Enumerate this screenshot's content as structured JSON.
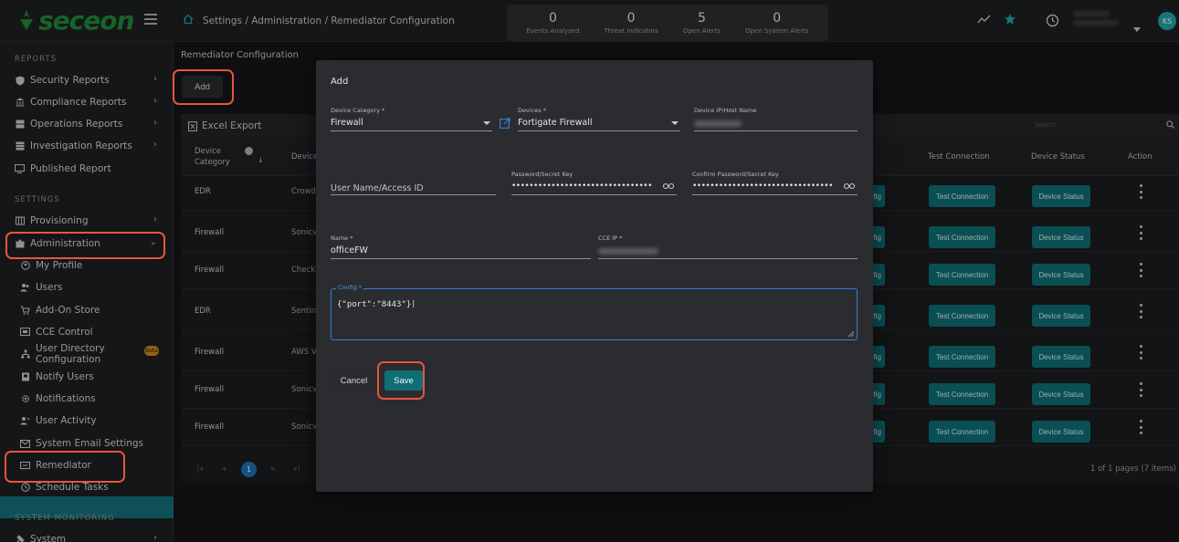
{
  "header": {
    "logo_text": "seceon",
    "breadcrumb": "Settings / Administration / Remediator Configuration",
    "stats": [
      {
        "value": "0",
        "label": "Events Analyzed"
      },
      {
        "value": "0",
        "label": "Threat Indicators"
      },
      {
        "value": "5",
        "label": "Open Alerts"
      },
      {
        "value": "0",
        "label": "Open System Alerts"
      }
    ],
    "avatar_initials": "KS",
    "brand_color": "#1f8a3a",
    "accent_color": "#12707a"
  },
  "sidebar": {
    "reports_title": "REPORTS",
    "reports": [
      {
        "label": "Security Reports",
        "icon": "shield-icon"
      },
      {
        "label": "Compliance Reports",
        "icon": "bank-icon"
      },
      {
        "label": "Operations Reports",
        "icon": "server-icon"
      },
      {
        "label": "Investigation Reports",
        "icon": "table-icon"
      },
      {
        "label": "Published Report",
        "icon": "monitor-icon"
      }
    ],
    "settings_title": "SETTINGS",
    "settings": [
      {
        "label": "Provisioning",
        "icon": "provisioning-icon"
      },
      {
        "label": "Administration",
        "icon": "admin-icon"
      }
    ],
    "admin_sub": [
      {
        "label": "My Profile",
        "icon": "profile-icon"
      },
      {
        "label": "Users",
        "icon": "users-icon"
      },
      {
        "label": "Add-On Store",
        "icon": "cart-icon"
      },
      {
        "label": "CCE Control",
        "icon": "control-icon"
      },
      {
        "label": "User Directory Configuration",
        "icon": "sitemap-icon"
      },
      {
        "label": "Notify Users",
        "icon": "notify-icon"
      },
      {
        "label": "Notifications",
        "icon": "gear-icon"
      },
      {
        "label": "User Activity",
        "icon": "activity-icon"
      },
      {
        "label": "System Email Settings",
        "icon": "mail-icon"
      },
      {
        "label": "Remediator",
        "icon": "remediator-icon"
      },
      {
        "label": "Schedule Tasks",
        "icon": "clock-icon"
      }
    ],
    "beta_label": "Beta",
    "monitoring_title": "SYSTEM MONITORING",
    "monitoring": [
      {
        "label": "System",
        "icon": "system-icon"
      }
    ]
  },
  "main": {
    "title": "Remediator Configuration",
    "add_label": "Add",
    "export_label": "Excel Export",
    "search_placeholder": "Search",
    "columns": {
      "device_category": "Device Category",
      "device": "Device",
      "test_connection": "Test Connection",
      "device_status": "Device Status",
      "action": "Action"
    },
    "config_btn_partial": "fig",
    "test_label": "Test Connection",
    "status_label": "Device Status",
    "rows": [
      {
        "category": "EDR",
        "device": "Crowd"
      },
      {
        "category": "Firewall",
        "device": "Sonicv"
      },
      {
        "category": "Firewall",
        "device": "Checkt"
      },
      {
        "category": "EDR",
        "device": "Sentin"
      },
      {
        "category": "Firewall",
        "device": "AWS V"
      },
      {
        "category": "Firewall",
        "device": "Sonicv"
      },
      {
        "category": "Firewall",
        "device": "Sonicv"
      }
    ],
    "page": "1",
    "pagination_text": "1 of 1 pages (7 items)"
  },
  "modal": {
    "title": "Add",
    "device_category_label": "Device Category *",
    "device_category_value": "Firewall",
    "devices_label": "Devices *",
    "devices_value": "Fortigate Firewall",
    "device_ip_label": "Device IP/Host Name",
    "username_placeholder": "User Name/Access ID",
    "password_label": "Password/Secret Key",
    "password_value": "••••••••••••••••••••••••••••••••",
    "confirm_password_label": "Confirm Password/Secret Key",
    "confirm_password_value": "••••••••••••••••••••••••••••••••",
    "name_label": "Name *",
    "name_value": "officeFW",
    "cce_ip_label": "CCE IP *",
    "config_label": "Config *",
    "config_value": "{\"port\":\"8443\"}",
    "cancel_label": "Cancel",
    "save_label": "Save"
  }
}
